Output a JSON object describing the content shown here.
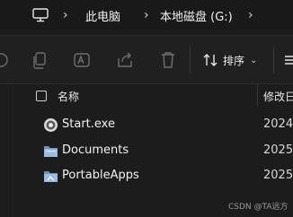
{
  "address_bar": {
    "icon": "monitor-icon",
    "crumbs": [
      "此电脑",
      "本地磁盘 (G:)"
    ]
  },
  "toolbar": {
    "icons": [
      "cut-icon",
      "copy-icon",
      "rename-icon",
      "share-icon",
      "delete-icon"
    ],
    "sort_label": "排序",
    "sort_icon": "sort-arrows-icon"
  },
  "columns": {
    "name": "名称",
    "modified": "修改日"
  },
  "files": [
    {
      "name": "Start.exe",
      "date": "2024/",
      "icon": "exe-app-icon"
    },
    {
      "name": "Documents",
      "date": "2025/",
      "icon": "folder-icon"
    },
    {
      "name": "PortableApps",
      "date": "2025/",
      "icon": "folder-icon"
    }
  ],
  "watermark": "CSDN @TA远方",
  "colors": {
    "background": "#1c1c1c",
    "toolbar": "#202020",
    "folder": "#8fb0d6"
  }
}
